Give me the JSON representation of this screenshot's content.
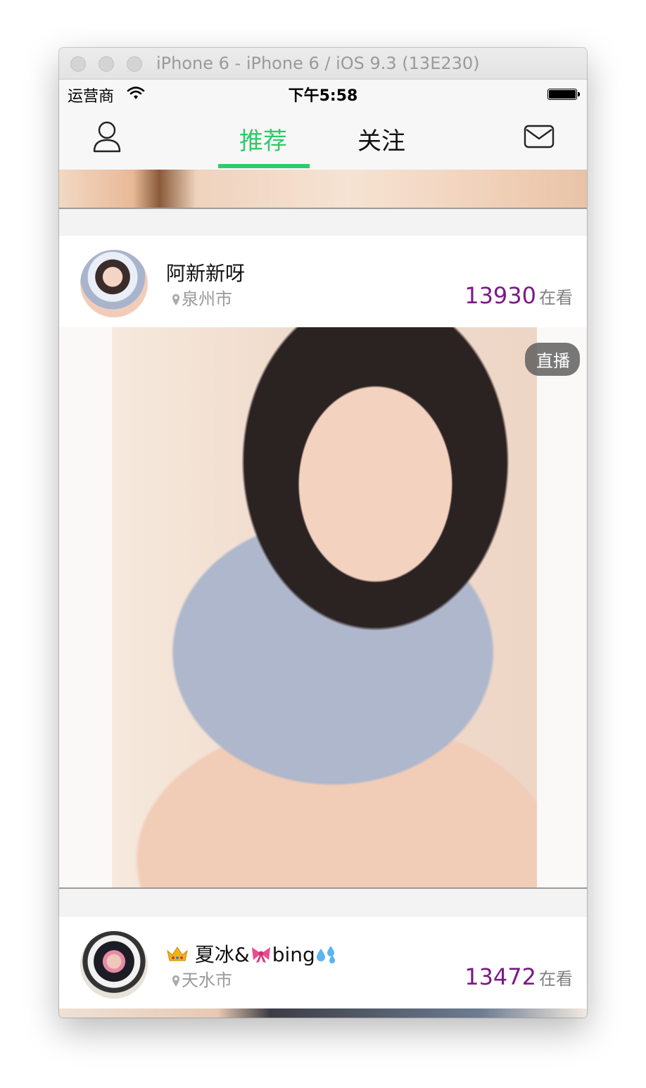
{
  "window": {
    "title": "iPhone 6 - iPhone 6 / iOS 9.3 (13E230)"
  },
  "status_bar": {
    "carrier": "运营商",
    "time": "下午5:58"
  },
  "nav": {
    "tab_recommend": "推荐",
    "tab_follow": "关注",
    "active_tab": "推荐",
    "accent_color": "#2ccc66"
  },
  "feed": {
    "cards": [
      {
        "username": "阿新新呀",
        "location": "泉州市",
        "viewer_count": "13930",
        "viewer_label": "在看",
        "badge": "直播"
      },
      {
        "username_prefix": "👑",
        "username": "夏冰&",
        "username_mid": "🎀",
        "username_suffix": "bing",
        "username_end": "💦",
        "location": "天水市",
        "viewer_count": "13472",
        "viewer_label": "在看"
      }
    ],
    "viewer_count_color": "#7b1a86"
  }
}
